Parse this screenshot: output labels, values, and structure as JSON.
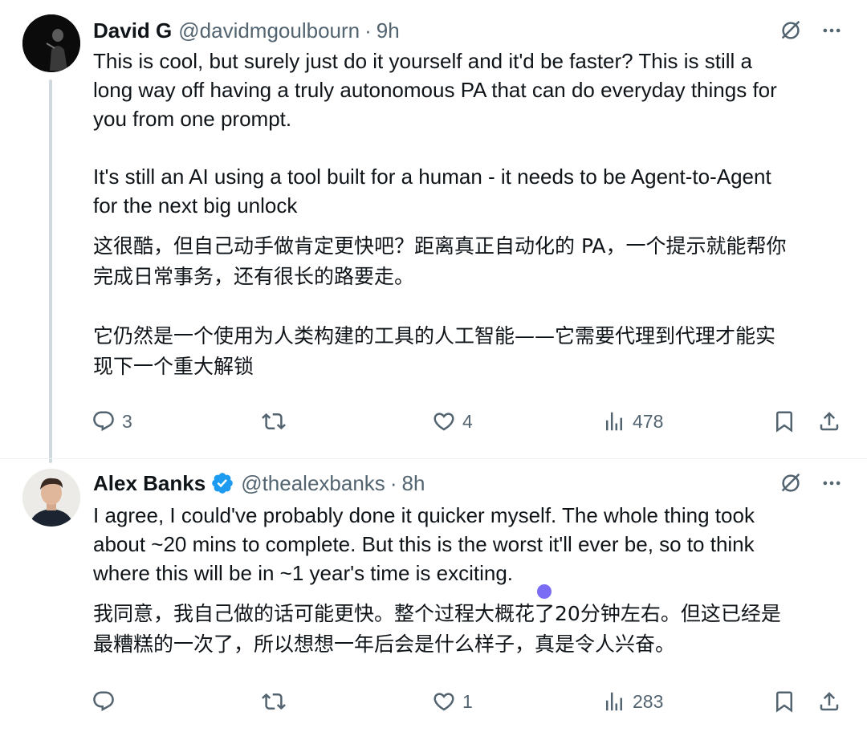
{
  "colors": {
    "accent": "#1d9bf0",
    "muted": "#536471",
    "text": "#0f1419",
    "line": "#cfd9de"
  },
  "tweets": [
    {
      "author": {
        "name": "David G",
        "handle": "@davidmgoulbourn",
        "verified": false
      },
      "separator": "·",
      "time": "9h",
      "text_en_1": [
        "This is cool, but surely just do it yourself and it'd be faster? This is still a",
        "long way off having a truly autonomous PA that can do everyday things for",
        "you from one prompt."
      ],
      "text_en_2": [
        "It's still an AI using a tool built for a human - it needs to be Agent-to-Agent",
        "for the next big unlock"
      ],
      "text_zh_1": [
        "这很酷，但自己动手做肯定更快吧？距离真正自动化的 PA，一个提示就能帮你",
        "完成日常事务，还有很长的路要走。"
      ],
      "text_zh_2": [
        "它仍然是一个使用为人类构建的工具的人工智能——它需要代理到代理才能实",
        "现下一个重大解锁"
      ],
      "stats": {
        "replies": "3",
        "retweets": "",
        "likes": "4",
        "views": "478"
      },
      "icons": [
        "grok-icon",
        "more-icon",
        "reply-icon",
        "retweet-icon",
        "like-icon",
        "views-icon",
        "bookmark-icon",
        "share-icon"
      ]
    },
    {
      "author": {
        "name": "Alex Banks",
        "handle": "@thealexbanks",
        "verified": true
      },
      "separator": "·",
      "time": "8h",
      "text_en_1": [
        "I agree, I could've probably done it quicker myself. The whole thing took",
        "about ~20 mins to complete. But this is the worst it'll ever be, so to think",
        "where this will be in ~1 year's time is exciting."
      ],
      "text_zh_1": [
        "我同意，我自己做的话可能更快。整个过程大概花了20分钟左右。但这已经是",
        "最糟糕的一次了，所以想想一年后会是什么样子，真是令人兴奋。"
      ],
      "stats": {
        "replies": "",
        "retweets": "",
        "likes": "1",
        "views": "283"
      },
      "icons": [
        "grok-icon",
        "more-icon",
        "reply-icon",
        "retweet-icon",
        "like-icon",
        "views-icon",
        "bookmark-icon",
        "share-icon"
      ]
    }
  ]
}
